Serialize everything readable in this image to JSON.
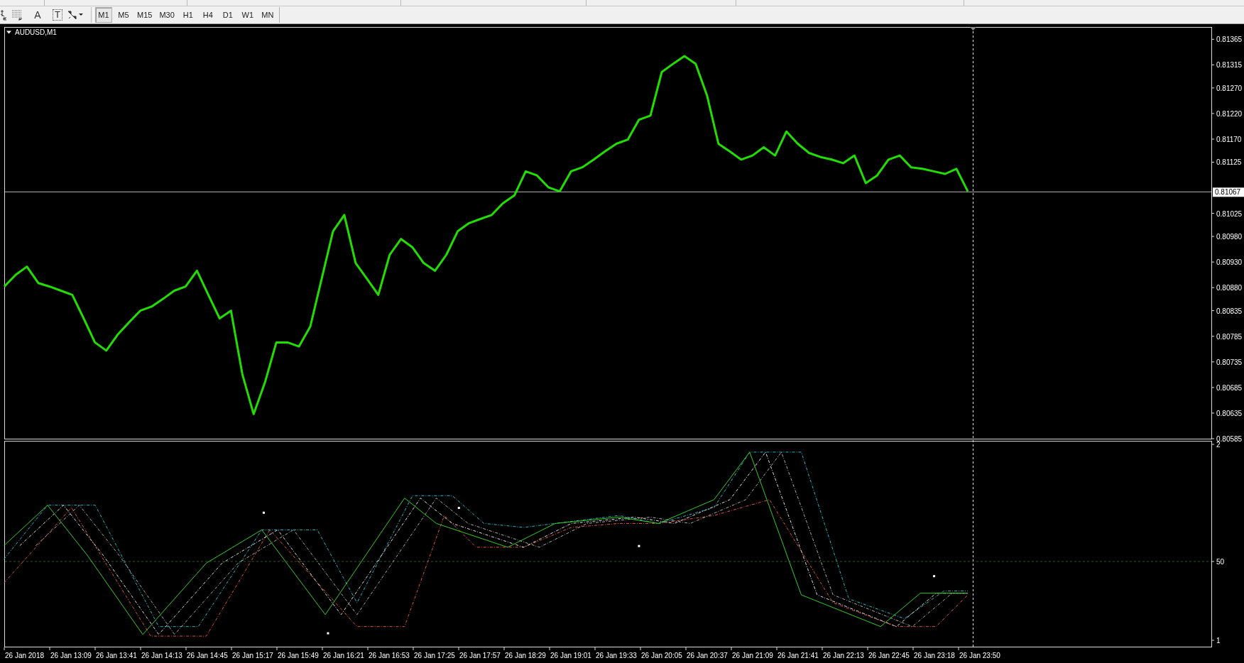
{
  "toolbar": {
    "text_tools": [
      "A",
      "T"
    ],
    "timeframes": [
      {
        "label": "M1",
        "selected": true
      },
      {
        "label": "M5",
        "selected": false
      },
      {
        "label": "M15",
        "selected": false
      },
      {
        "label": "M30",
        "selected": false
      },
      {
        "label": "H1",
        "selected": false
      },
      {
        "label": "H4",
        "selected": false
      },
      {
        "label": "D1",
        "selected": false
      },
      {
        "label": "W1",
        "selected": false
      },
      {
        "label": "MN",
        "selected": false
      }
    ]
  },
  "chart": {
    "symbol": "AUDUSD,M1",
    "current_price": "0.81067",
    "price_axis": [
      "0.81365",
      "0.81315",
      "0.81270",
      "0.81220",
      "0.81170",
      "0.81125",
      "0.81025",
      "0.80980",
      "0.80930",
      "0.80880",
      "0.80835",
      "0.80785",
      "0.80735",
      "0.80685",
      "0.80635",
      "0.80585"
    ],
    "time_axis": [
      "26 Jan 2018",
      "26 Jan 13:09",
      "26 Jan 13:41",
      "26 Jan 14:13",
      "26 Jan 14:45",
      "26 Jan 15:17",
      "26 Jan 15:49",
      "26 Jan 16:21",
      "26 Jan 16:53",
      "26 Jan 17:25",
      "26 Jan 17:57",
      "26 Jan 18:29",
      "26 Jan 19:01",
      "26 Jan 19:33",
      "26 Jan 20:05",
      "26 Jan 20:37",
      "26 Jan 21:09",
      "26 Jan 21:41",
      "26 Jan 22:13",
      "26 Jan 22:45",
      "26 Jan 23:18",
      "26 Jan 23:50"
    ]
  },
  "indicator": {
    "axis": [
      "2",
      "50",
      "1"
    ]
  }
}
